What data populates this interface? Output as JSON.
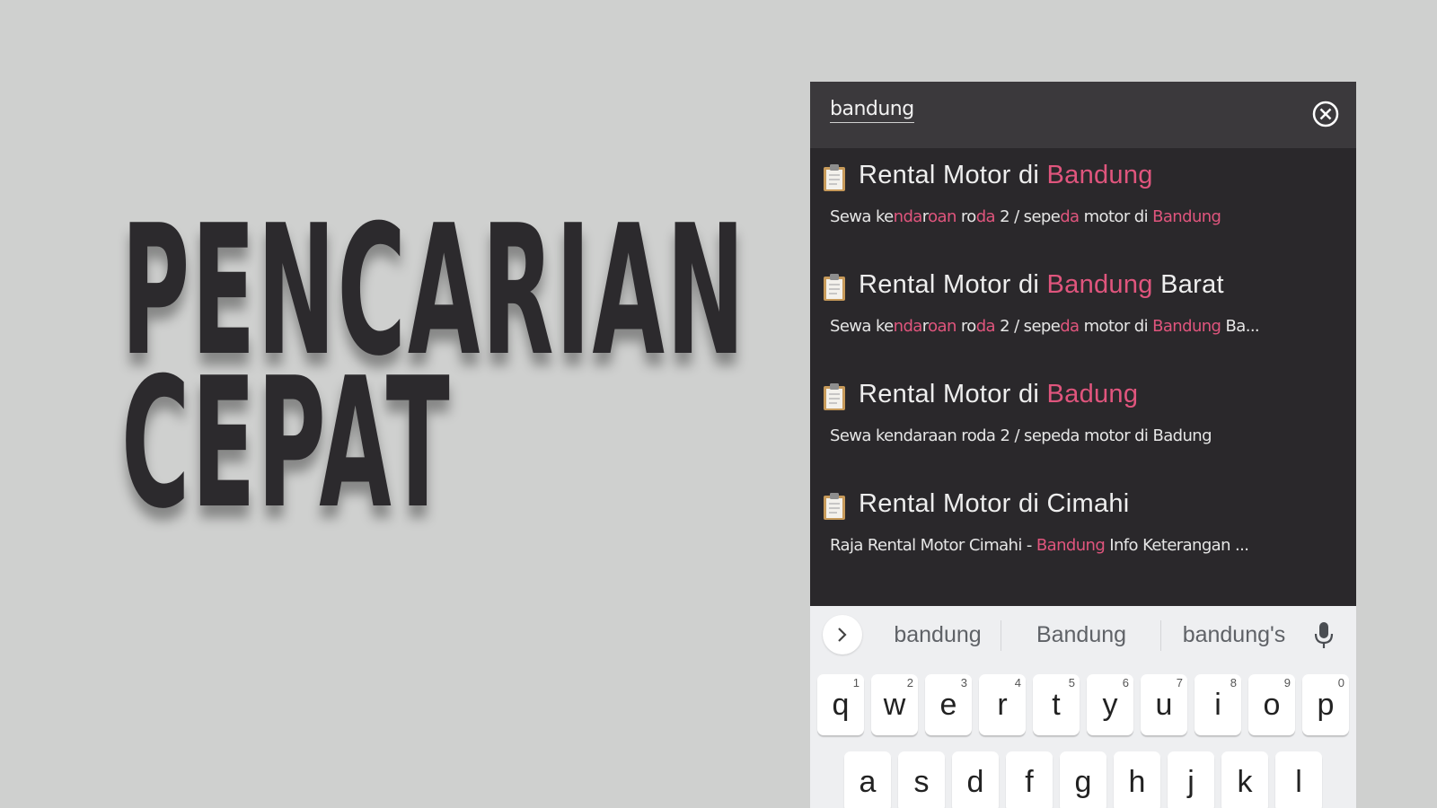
{
  "headline": {
    "line1": "PENCARIAN",
    "line2": "CEPAT"
  },
  "search": {
    "value": "bandung",
    "clear_icon": "clear-circle-icon"
  },
  "results": [
    {
      "icon": "clipboard-icon",
      "title": [
        {
          "t": "Rental Motor di ",
          "h": false
        },
        {
          "t": "Bandung",
          "h": true
        }
      ],
      "sub": [
        {
          "t": "Sewa ke",
          "h": false
        },
        {
          "t": "nda",
          "h": true
        },
        {
          "t": "r",
          "h": false
        },
        {
          "t": "oan",
          "h": true
        },
        {
          "t": " ro",
          "h": false
        },
        {
          "t": "da",
          "h": true
        },
        {
          "t": " 2 / sepe",
          "h": false
        },
        {
          "t": "da",
          "h": true
        },
        {
          "t": " motor di ",
          "h": false
        },
        {
          "t": "Bandung",
          "h": true
        }
      ]
    },
    {
      "icon": "clipboard-icon",
      "title": [
        {
          "t": "Rental Motor di ",
          "h": false
        },
        {
          "t": "Bandung",
          "h": true
        },
        {
          "t": " Barat",
          "h": false
        }
      ],
      "sub": [
        {
          "t": "Sewa ke",
          "h": false
        },
        {
          "t": "nda",
          "h": true
        },
        {
          "t": "r",
          "h": false
        },
        {
          "t": "oan",
          "h": true
        },
        {
          "t": " ro",
          "h": false
        },
        {
          "t": "da",
          "h": true
        },
        {
          "t": " 2 / sepe",
          "h": false
        },
        {
          "t": "da",
          "h": true
        },
        {
          "t": " motor di ",
          "h": false
        },
        {
          "t": "Bandung",
          "h": true
        },
        {
          "t": " Ba...",
          "h": false
        }
      ]
    },
    {
      "icon": "clipboard-icon",
      "title": [
        {
          "t": "Rental Motor di ",
          "h": false
        },
        {
          "t": "Badung",
          "h": true
        }
      ],
      "sub": [
        {
          "t": "Sewa kendaraan roda 2 / sepeda motor di Badung",
          "h": false
        }
      ]
    },
    {
      "icon": "clipboard-icon",
      "title": [
        {
          "t": "Rental Motor di Cimahi",
          "h": false
        }
      ],
      "sub": [
        {
          "t": "Raja Rental Motor Cimahi - ",
          "h": false
        },
        {
          "t": "Bandung",
          "h": true
        },
        {
          "t": " Info Keterangan ...",
          "h": false
        }
      ]
    }
  ],
  "keyboard": {
    "suggestions": [
      "bandung",
      "Bandung",
      "bandung's"
    ],
    "row1": [
      {
        "k": "q",
        "n": "1"
      },
      {
        "k": "w",
        "n": "2"
      },
      {
        "k": "e",
        "n": "3"
      },
      {
        "k": "r",
        "n": "4"
      },
      {
        "k": "t",
        "n": "5"
      },
      {
        "k": "y",
        "n": "6"
      },
      {
        "k": "u",
        "n": "7"
      },
      {
        "k": "i",
        "n": "8"
      },
      {
        "k": "o",
        "n": "9"
      },
      {
        "k": "p",
        "n": "0"
      }
    ],
    "row2": [
      "a",
      "s",
      "d",
      "f",
      "g",
      "h",
      "j",
      "k",
      "l"
    ]
  },
  "colors": {
    "highlight": "#e0557d",
    "panel": "#2a282b",
    "search_bar": "#3b393c",
    "background": "#cfd0cf"
  }
}
